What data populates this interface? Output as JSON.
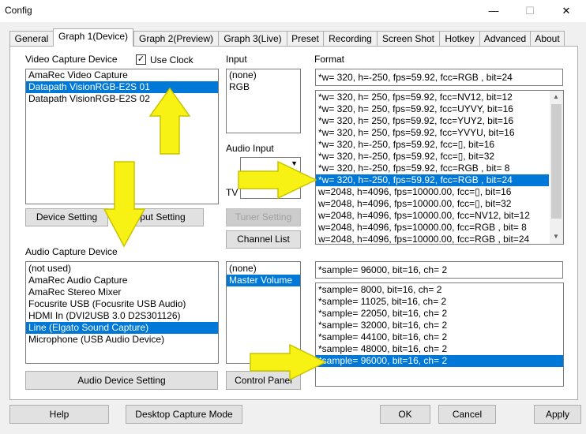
{
  "window": {
    "title": "Config",
    "minimize_glyph": "—",
    "maximize_glyph": "☐",
    "close_glyph": "✕"
  },
  "tabs": [
    "General",
    "Graph 1(Device)",
    "Graph 2(Preview)",
    "Graph 3(Live)",
    "Preset",
    "Recording",
    "Screen Shot",
    "Hotkey",
    "Advanced",
    "About"
  ],
  "video": {
    "label": "Video Capture Device",
    "use_clock_label": "Use Clock",
    "use_clock_checked": "✓",
    "devices": [
      "AmaRec Video Capture",
      "Datapath VisionRGB-E2S 01",
      "Datapath VisionRGB-E2S 02"
    ],
    "selected_index": 1,
    "device_setting": "Device Setting",
    "input_setting": "Input Setting"
  },
  "input": {
    "label": "Input",
    "items": [
      "(none)",
      "RGB"
    ],
    "audio_input_label": "Audio Input",
    "tv_label": "TV",
    "tuner_setting": "Tuner Setting",
    "channel_list": "Channel List"
  },
  "format": {
    "label": "Format",
    "current": "*w= 320, h=-250, fps=59.92,  fcc=RGB , bit=24",
    "items": [
      "*w= 320, h= 250, fps=59.92,  fcc=NV12, bit=12",
      "*w= 320, h= 250, fps=59.92,  fcc=UYVY, bit=16",
      "*w= 320, h= 250, fps=59.92,  fcc=YUY2, bit=16",
      "*w= 320, h= 250, fps=59.92,  fcc=YVYU, bit=16",
      "*w= 320, h=-250, fps=59.92,  fcc=▯, bit=16",
      "*w= 320, h=-250, fps=59.92,  fcc=▯, bit=32",
      "*w= 320, h=-250, fps=59.92,  fcc=RGB , bit= 8",
      "*w= 320, h=-250, fps=59.92,  fcc=RGB , bit=24",
      "w=2048, h=4096, fps=10000.00,  fcc=▯, bit=16",
      "w=2048, h=4096, fps=10000.00,  fcc=▯, bit=32",
      "w=2048, h=4096, fps=10000.00,  fcc=NV12, bit=12",
      "w=2048, h=4096, fps=10000.00,  fcc=RGB , bit= 8",
      "w=2048, h=4096, fps=10000.00,  fcc=RGB , bit=24"
    ],
    "selected_index": 7
  },
  "audio": {
    "label": "Audio Capture Device",
    "devices": [
      "(not used)",
      "AmaRec Audio Capture",
      "AmaRec Stereo Mixer",
      "Focusrite USB (Focusrite USB Audio)",
      "HDMI In (DVI2USB 3.0 D2S301126)",
      "Line (Elgato Sound Capture)",
      "Microphone (USB Audio Device)"
    ],
    "selected_index": 5,
    "device_setting": "Audio Device Setting",
    "inputs": [
      "(none)",
      "Master Volume"
    ],
    "input_selected_index": 1,
    "control_panel": "Control Panel"
  },
  "sample": {
    "current": "*sample= 96000, bit=16, ch= 2",
    "items": [
      "*sample=  8000, bit=16, ch= 2",
      "*sample= 11025, bit=16, ch= 2",
      "*sample= 22050, bit=16, ch= 2",
      "*sample= 32000, bit=16, ch= 2",
      "*sample= 44100, bit=16, ch= 2",
      "*sample= 48000, bit=16, ch= 2",
      "*sample= 96000, bit=16, ch= 2"
    ],
    "selected_index": 6
  },
  "footer": {
    "help": "Help",
    "desktop_capture": "Desktop Capture Mode",
    "ok": "OK",
    "cancel": "Cancel",
    "apply": "Apply"
  },
  "colors": {
    "selection": "#0078d7",
    "annotation_arrow": "#f7f213",
    "annotation_stroke": "#c9c400"
  }
}
